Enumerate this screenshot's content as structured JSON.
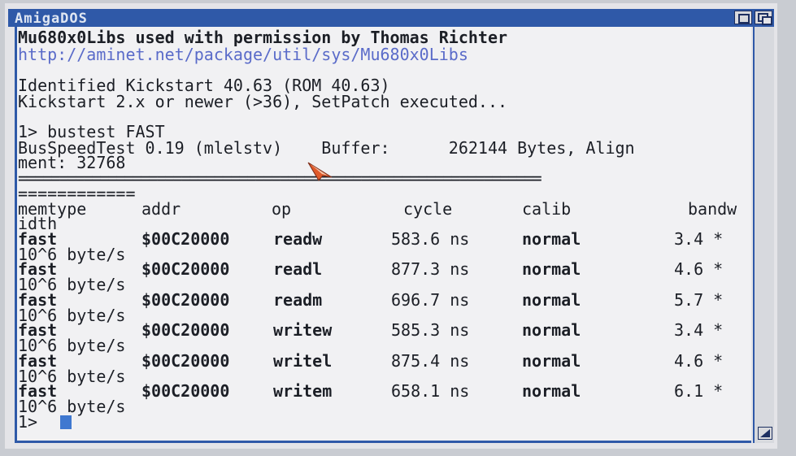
{
  "window": {
    "title": "AmigaDOS"
  },
  "console": {
    "lines": [
      "Mu680x0Libs used with permission by Thomas Richter",
      "http://aminet.net/package/util/sys/Mu680x0Libs",
      "",
      "Identified Kickstart 40.63 (ROM 40.63)",
      "Kickstart 2.x or newer (>36), SetPatch executed...",
      "",
      "1> bustest FAST",
      "BusSpeedTest 0.19 (mlelstv)    Buffer:      262144 Bytes, Align",
      "ment: 32768",
      "================================================================",
      "============"
    ],
    "table": {
      "headers": [
        "memtype",
        "addr",
        "op",
        "cycle",
        "calib",
        "bandw"
      ],
      "header_wrap": "idth",
      "rows": [
        {
          "memtype": "fast",
          "addr": "$00C20000",
          "op": "readw",
          "cycle": "583.6 ns",
          "calib": "normal",
          "bandwidth": "3.4 *",
          "unit": "10^6 byte/s"
        },
        {
          "memtype": "fast",
          "addr": "$00C20000",
          "op": "readl",
          "cycle": "877.3 ns",
          "calib": "normal",
          "bandwidth": "4.6 *",
          "unit": "10^6 byte/s"
        },
        {
          "memtype": "fast",
          "addr": "$00C20000",
          "op": "readm",
          "cycle": "696.7 ns",
          "calib": "normal",
          "bandwidth": "5.7 *",
          "unit": "10^6 byte/s"
        },
        {
          "memtype": "fast",
          "addr": "$00C20000",
          "op": "writew",
          "cycle": "585.3 ns",
          "calib": "normal",
          "bandwidth": "3.4 *",
          "unit": "10^6 byte/s"
        },
        {
          "memtype": "fast",
          "addr": "$00C20000",
          "op": "writel",
          "cycle": "875.4 ns",
          "calib": "normal",
          "bandwidth": "4.6 *",
          "unit": "10^6 byte/s"
        },
        {
          "memtype": "fast",
          "addr": "$00C20000",
          "op": "writem",
          "cycle": "658.1 ns",
          "calib": "normal",
          "bandwidth": "6.1 *",
          "unit": "10^6 byte/s"
        }
      ]
    },
    "prompt": "1>"
  },
  "icons": [
    "zoom-gadget-icon",
    "depth-gadget-icon",
    "size-gadget-icon",
    "mouse-pointer-icon"
  ],
  "colors": {
    "titlebar": "#2f59a8",
    "text": "#1c1f26",
    "link": "#5a6bc9",
    "cursor": "#3f78d0",
    "pointer": "#e05a2a"
  }
}
